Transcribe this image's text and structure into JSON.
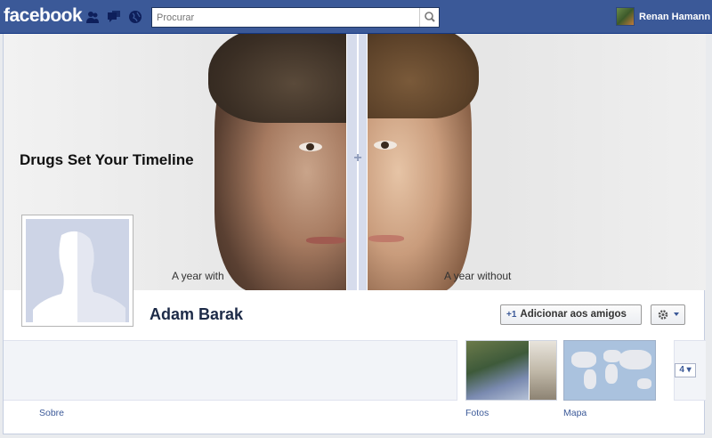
{
  "topbar": {
    "logo": "facebook",
    "search_placeholder": "Procurar",
    "user_name": "Renan Hamann",
    "jewels": [
      "friend-requests-icon",
      "messages-icon",
      "notifications-icon"
    ]
  },
  "cover": {
    "title": "Drugs Set Your Timeline",
    "caption_left": "A year with",
    "caption_right": "A year without"
  },
  "profile": {
    "name": "Adam Barak",
    "add_friend_label": "Adicionar aos amigos",
    "add_friend_prefix": "+1"
  },
  "sections": {
    "about_label": "Sobre",
    "photos_label": "Fotos",
    "map_label": "Mapa",
    "more_count": "4"
  },
  "colors": {
    "brand": "#3b5998",
    "name_text": "#1c2a47"
  }
}
